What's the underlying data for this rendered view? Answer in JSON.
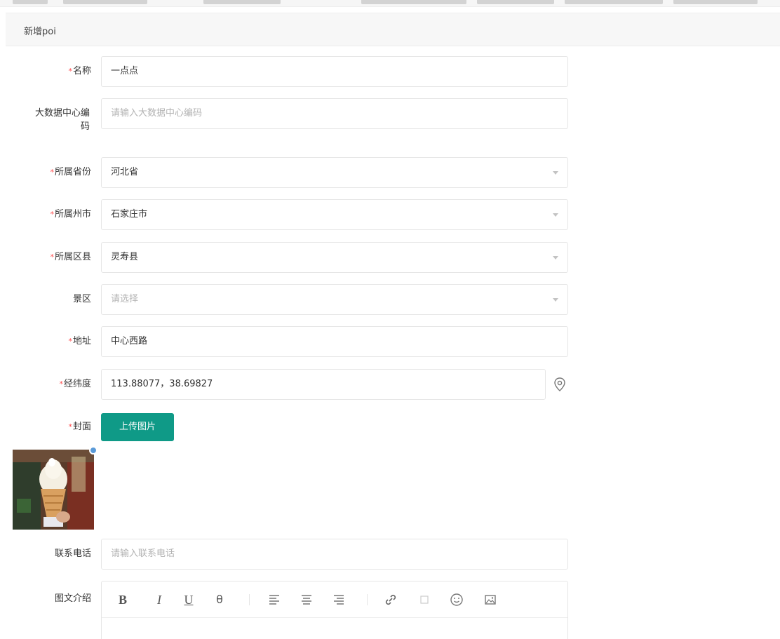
{
  "page": {
    "title": "新增poi"
  },
  "form": {
    "name": {
      "label": "名称",
      "required": true,
      "value": "一点点"
    },
    "bigdata_code": {
      "label": "大数据中心编码",
      "required": false,
      "placeholder": "请输入大数据中心编码"
    },
    "province": {
      "label": "所属省份",
      "required": true,
      "value": "河北省"
    },
    "city": {
      "label": "所属州市",
      "required": true,
      "value": "石家庄市"
    },
    "district": {
      "label": "所属区县",
      "required": true,
      "value": "灵寿县"
    },
    "scenic": {
      "label": "景区",
      "required": false,
      "placeholder": "请选择"
    },
    "address": {
      "label": "地址",
      "required": true,
      "value": "中心西路"
    },
    "coords": {
      "label": "经纬度",
      "required": true,
      "value": "113.88077，38.69827",
      "icon": "location-pin-icon"
    },
    "cover": {
      "label": "封面",
      "required": true,
      "button": "上传图片"
    },
    "phone": {
      "label": "联系电话",
      "required": false,
      "placeholder": "请输入联系电话"
    },
    "intro": {
      "label": "图文介绍",
      "required": false
    }
  },
  "editor_toolbar": {
    "bold": "B",
    "italic": "I",
    "underline": "U",
    "strike": "θ",
    "icons": [
      "bold-icon",
      "italic-icon",
      "underline-icon",
      "strikethrough-icon",
      "align-left-icon",
      "align-center-icon",
      "align-right-icon",
      "link-icon",
      "code-icon",
      "emoji-icon",
      "image-icon"
    ]
  },
  "colors": {
    "primary": "#0f9a87",
    "required": "#ff4d4f",
    "border": "#e6e6e6",
    "placeholder": "#b3b3b3"
  }
}
